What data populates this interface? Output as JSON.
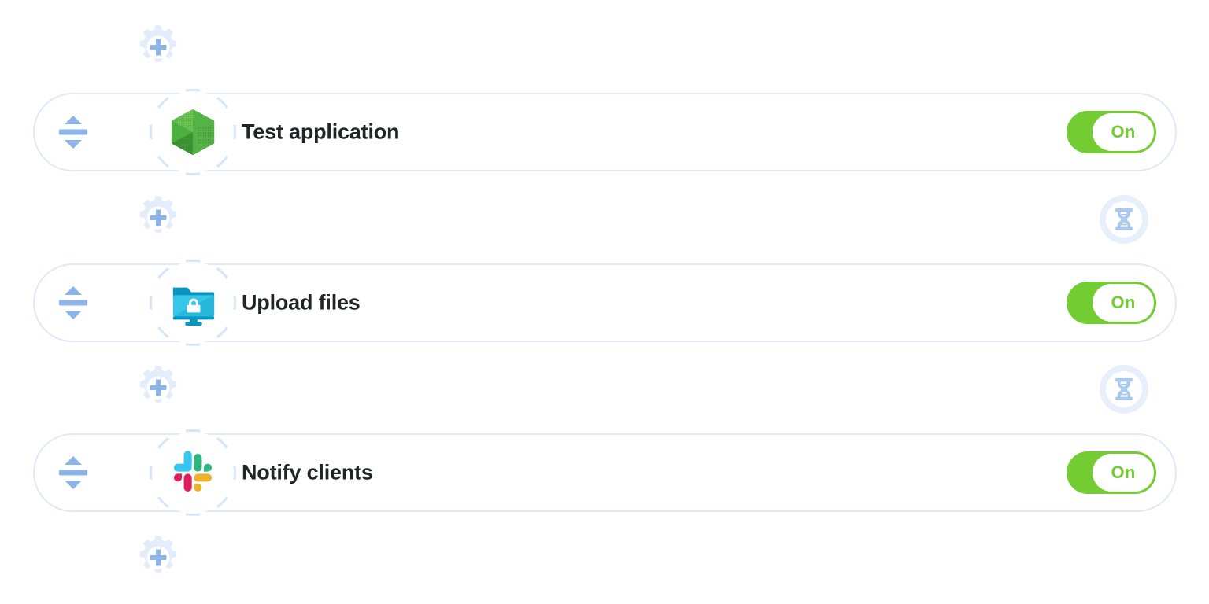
{
  "canvas": {
    "background_color": "#ffffff",
    "accent_color": "#8cb4e8",
    "gear_color": "#d9e7fa",
    "card_border_color": "#dfe9f7",
    "toggle_on_color": "#72cc32"
  },
  "add_buttons": [
    {
      "name": "add-step-top",
      "icon": "plus-gear-icon",
      "label": "Add step"
    },
    {
      "name": "add-step-1",
      "icon": "plus-gear-icon",
      "label": "Add step"
    },
    {
      "name": "add-step-2",
      "icon": "plus-gear-icon",
      "label": "Add step"
    },
    {
      "name": "add-step-bottom",
      "icon": "plus-gear-icon",
      "label": "Add step"
    }
  ],
  "delay_badges": [
    {
      "name": "delay-badge-1",
      "icon": "hourglass-icon"
    },
    {
      "name": "delay-badge-2",
      "icon": "hourglass-icon"
    }
  ],
  "steps": [
    {
      "id": "step-test-application",
      "title": "Test application",
      "app_icon": "node-cube-icon",
      "handle_icon": "reorder-handle-icon",
      "toggle": {
        "state_label": "On",
        "checked": true
      }
    },
    {
      "id": "step-upload-files",
      "title": "Upload files",
      "app_icon": "secure-folder-icon",
      "handle_icon": "reorder-handle-icon",
      "toggle": {
        "state_label": "On",
        "checked": true
      }
    },
    {
      "id": "step-notify-clients",
      "title": "Notify clients",
      "app_icon": "slack-icon",
      "handle_icon": "reorder-handle-icon",
      "toggle": {
        "state_label": "On",
        "checked": true
      }
    }
  ]
}
